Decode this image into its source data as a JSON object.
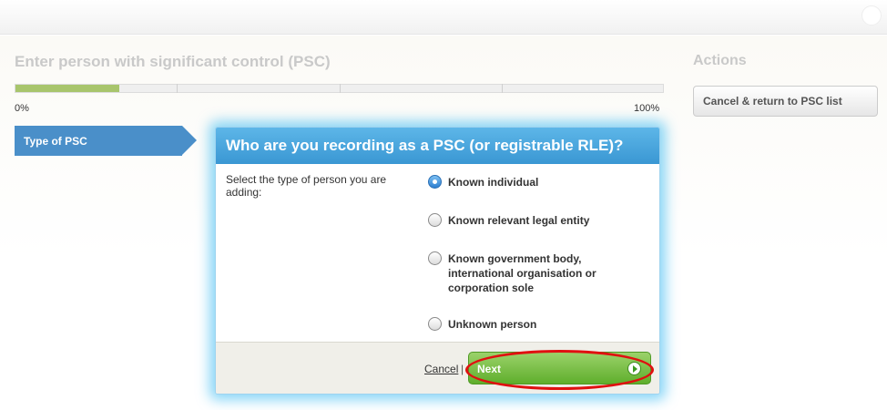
{
  "wizard": {
    "title": "Enter person with significant control (PSC)",
    "progress": {
      "start_label": "0%",
      "end_label": "100%",
      "fraction": 0.16
    },
    "current_step": "Type of PSC"
  },
  "actions": {
    "title": "Actions",
    "cancel_return_label": "Cancel & return to PSC list"
  },
  "dialog": {
    "title": "Who are you recording as a PSC (or registrable RLE)?",
    "prompt": "Select the type of person you are adding:",
    "options": [
      {
        "label": "Known individual",
        "selected": true
      },
      {
        "label": "Known relevant legal entity",
        "selected": false
      },
      {
        "label": "Known government body, international organisation or corporation sole",
        "selected": false
      },
      {
        "label": "Unknown person",
        "selected": false
      }
    ],
    "footer": {
      "cancel_label": "Cancel",
      "separator": "|",
      "next_label": "Next"
    }
  },
  "colors": {
    "accent_blue": "#4a8fc9",
    "next_green": "#5fae2c",
    "highlight_red": "#e01010"
  }
}
